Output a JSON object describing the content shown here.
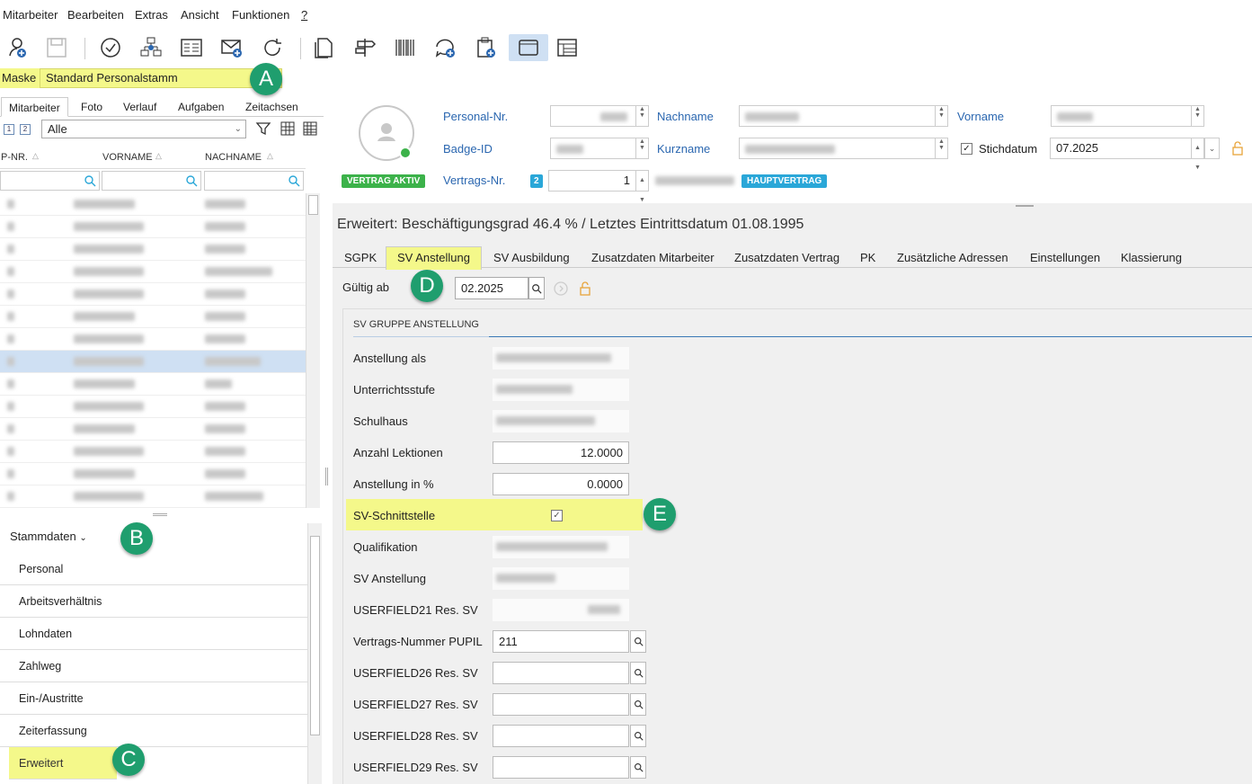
{
  "menu": [
    "Mitarbeiter",
    "Bearbeiten",
    "Extras",
    "Ansicht",
    "Funktionen",
    "?"
  ],
  "toolbar_icons": [
    "add-user-icon",
    "save-icon",
    "check-icon",
    "network-icon",
    "list-icon",
    "mail-add-icon",
    "refresh-icon",
    "document-icon",
    "signpost-icon",
    "barcode-icon",
    "chat-add-icon",
    "clipboard-add-icon",
    "window-icon",
    "grid-icon"
  ],
  "maske": {
    "label": "Maske",
    "value": "Standard Personalstamm"
  },
  "badges": {
    "a": "A",
    "b": "B",
    "c": "C",
    "d": "D",
    "e": "E"
  },
  "left_tabs": [
    "Mitarbeiter",
    "Foto",
    "Verlauf",
    "Aufgaben",
    "Zeitachsen"
  ],
  "filter": {
    "btn1": "1",
    "btn2": "2",
    "select": "Alle"
  },
  "columns": [
    "P-NR.",
    "VORNAME",
    "NACHNAME"
  ],
  "nav": {
    "head": "Stammdaten",
    "items": [
      "Personal",
      "Arbeitsverhältnis",
      "Lohndaten",
      "Zahlweg",
      "Ein-/Austritte",
      "Zeiterfassung",
      "Erweitert"
    ]
  },
  "header": {
    "personal_nr_label": "Personal-Nr.",
    "nachname_label": "Nachname",
    "vorname_label": "Vorname",
    "badge_label": "Badge-ID",
    "kurzname_label": "Kurzname",
    "stichdatum_label": "Stichdatum",
    "stichdatum_value": "07.2025",
    "vertrag_status": "VERTRAG AKTIV",
    "vertrags_label": "Vertrags-Nr.",
    "vertrags_count": "2",
    "vertrags_value": "1",
    "hauptvertrag": "HAUPTVERTRAG"
  },
  "subtitle": "Erweitert: Beschäftigungsgrad 46.4 % / Letztes Eintrittsdatum 01.08.1995",
  "tabs": [
    "SGPK",
    "SV Anstellung",
    "SV Ausbildung",
    "Zusatzdaten Mitarbeiter",
    "Zusatzdaten Vertrag",
    "PK",
    "Zusätzliche Adressen",
    "Einstellungen",
    "Klassierung"
  ],
  "gueltig": {
    "label": "Gültig ab",
    "value": "02.2025"
  },
  "group_title": "SV GRUPPE ANSTELLUNG",
  "fields": {
    "anstellung_als": "Anstellung als",
    "unterrichtsstufe": "Unterrichtsstufe",
    "schulhaus": "Schulhaus",
    "lektionen_label": "Anzahl Lektionen",
    "lektionen_value": "12.0000",
    "prozent_label": "Anstellung in %",
    "prozent_value": "0.0000",
    "schnittstelle": "SV-Schnittstelle",
    "qualifikation": "Qualifikation",
    "sv_anstellung": "SV Anstellung",
    "uf21": "USERFIELD21 Res. SV",
    "pupil_label": "Vertrags-Nummer PUPIL",
    "pupil_value": "211",
    "uf26": "USERFIELD26 Res. SV",
    "uf27": "USERFIELD27 Res. SV",
    "uf28": "USERFIELD28 Res. SV",
    "uf29": "USERFIELD29 Res. SV"
  },
  "colors": {
    "highlight": "#f4f88a",
    "badge": "#1f9e6e",
    "selected_row": "#cfe0f3",
    "link_blue": "#2b67b0",
    "status_green": "#3cb24a",
    "pill_blue": "#2aa7d8"
  }
}
